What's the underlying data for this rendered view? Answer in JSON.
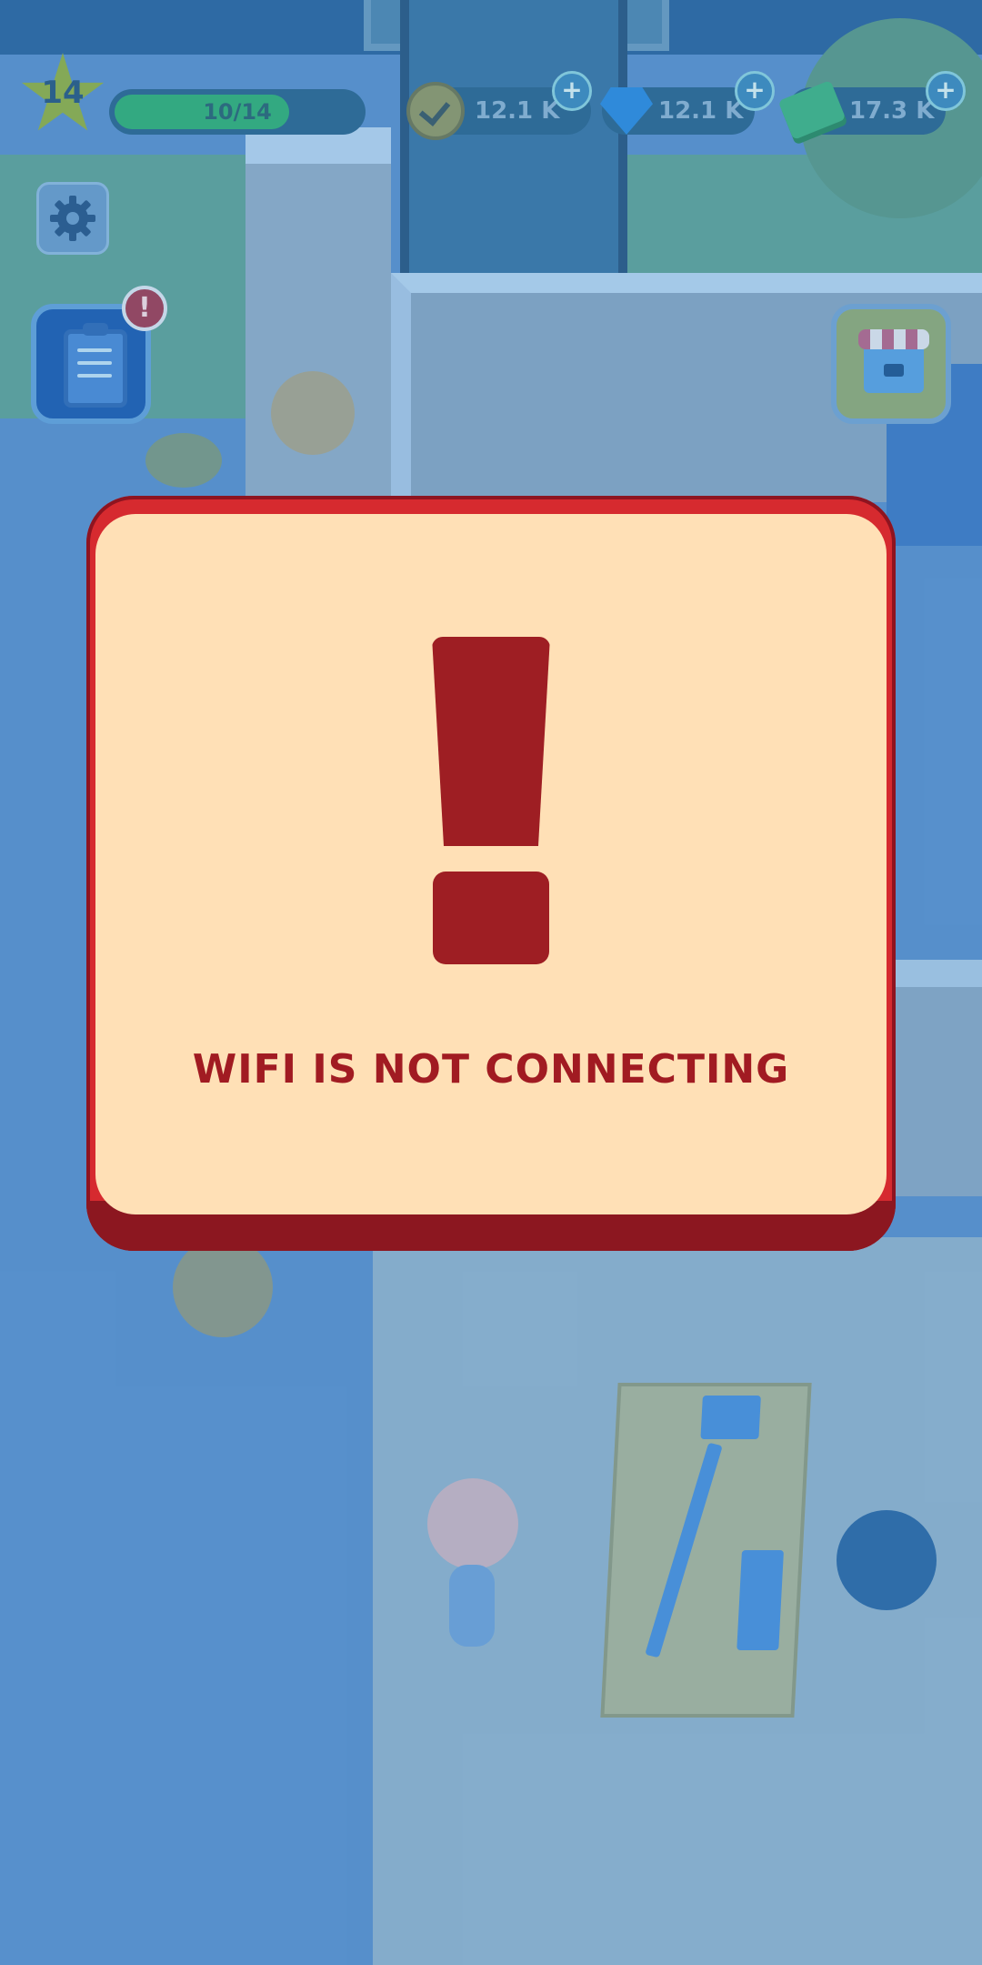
{
  "hud": {
    "level": "14",
    "progress_text": "10/14",
    "progress_fraction": 0.71,
    "coins": "12.1 K",
    "gems": "12.1 K",
    "cash": "17.3 K",
    "plus_label": "+"
  },
  "buttons": {
    "settings_icon": "gear-icon",
    "tasks_icon": "clipboard-icon",
    "tasks_badge": "!",
    "shop_icon": "shop-icon"
  },
  "modal": {
    "icon": "exclamation-icon",
    "message": "WIFI IS NOT CONNECTING"
  },
  "colors": {
    "modal_border": "#d62a2f",
    "modal_fill": "#ffe0b6",
    "message_text": "#a11b22",
    "progress_fill": "#33b27a"
  }
}
